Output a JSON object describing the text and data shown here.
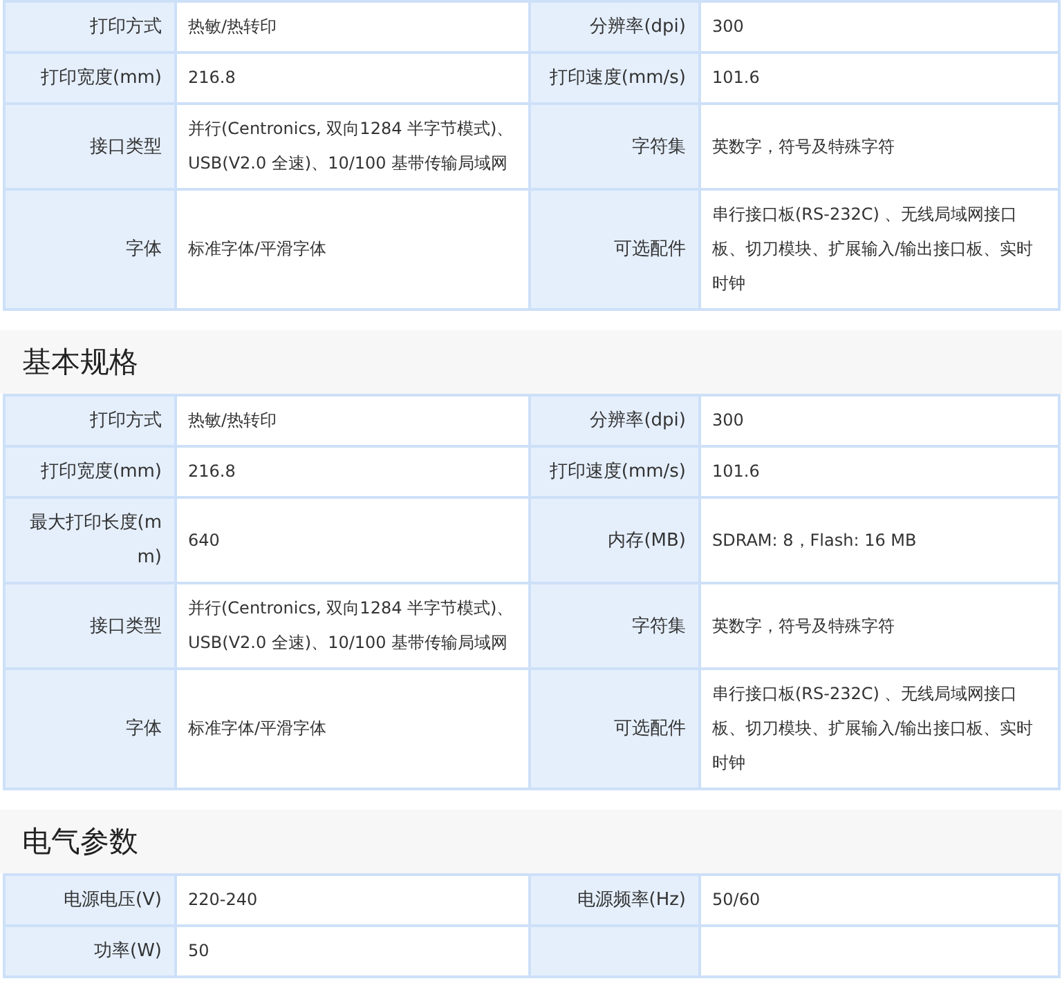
{
  "sections": [
    {
      "rows": [
        {
          "cells": [
            {
              "label": "打印方式",
              "value": "热敏/热转印"
            },
            {
              "label": "分辨率(dpi)",
              "value": "300"
            }
          ]
        },
        {
          "cells": [
            {
              "label": "打印宽度(mm)",
              "value": "216.8"
            },
            {
              "label": "打印速度(mm/s)",
              "value": "101.6"
            }
          ]
        },
        {
          "cells": [
            {
              "label": "接口类型",
              "value": "并行(Centronics, 双向1284 半字节模式)、USB(V2.0 全速)、10/100 基带传输局域网"
            },
            {
              "label": "字符集",
              "value": "英数字，符号及特殊字符"
            }
          ]
        },
        {
          "cells": [
            {
              "label": "字体",
              "value": "标准字体/平滑字体"
            },
            {
              "label": "可选配件",
              "value": "串行接口板(RS-232C) 、无线局域网接口板、切刀模块、扩展输入/输出接口板、实时时钟"
            }
          ]
        }
      ]
    },
    {
      "title": "基本规格",
      "rows": [
        {
          "cells": [
            {
              "label": "打印方式",
              "value": "热敏/热转印"
            },
            {
              "label": "分辨率(dpi)",
              "value": "300"
            }
          ]
        },
        {
          "cells": [
            {
              "label": "打印宽度(mm)",
              "value": "216.8"
            },
            {
              "label": "打印速度(mm/s)",
              "value": "101.6"
            }
          ]
        },
        {
          "cells": [
            {
              "label": "最大打印长度(mm)",
              "value": "640"
            },
            {
              "label": "内存(MB)",
              "value": "SDRAM: 8，Flash: 16 MB"
            }
          ]
        },
        {
          "cells": [
            {
              "label": "接口类型",
              "value": "并行(Centronics, 双向1284 半字节模式)、USB(V2.0 全速)、10/100 基带传输局域网"
            },
            {
              "label": "字符集",
              "value": "英数字，符号及特殊字符"
            }
          ]
        },
        {
          "cells": [
            {
              "label": "字体",
              "value": "标准字体/平滑字体"
            },
            {
              "label": "可选配件",
              "value": "串行接口板(RS-232C) 、无线局域网接口板、切刀模块、扩展输入/输出接口板、实时时钟"
            }
          ]
        }
      ]
    },
    {
      "title": "电气参数",
      "rows": [
        {
          "cells": [
            {
              "label": "电源电压(V)",
              "value": "220-240"
            },
            {
              "label": "电源频率(Hz)",
              "value": "50/60"
            }
          ]
        },
        {
          "cells": [
            {
              "label": "功率(W)",
              "value": "50"
            }
          ]
        }
      ]
    }
  ]
}
